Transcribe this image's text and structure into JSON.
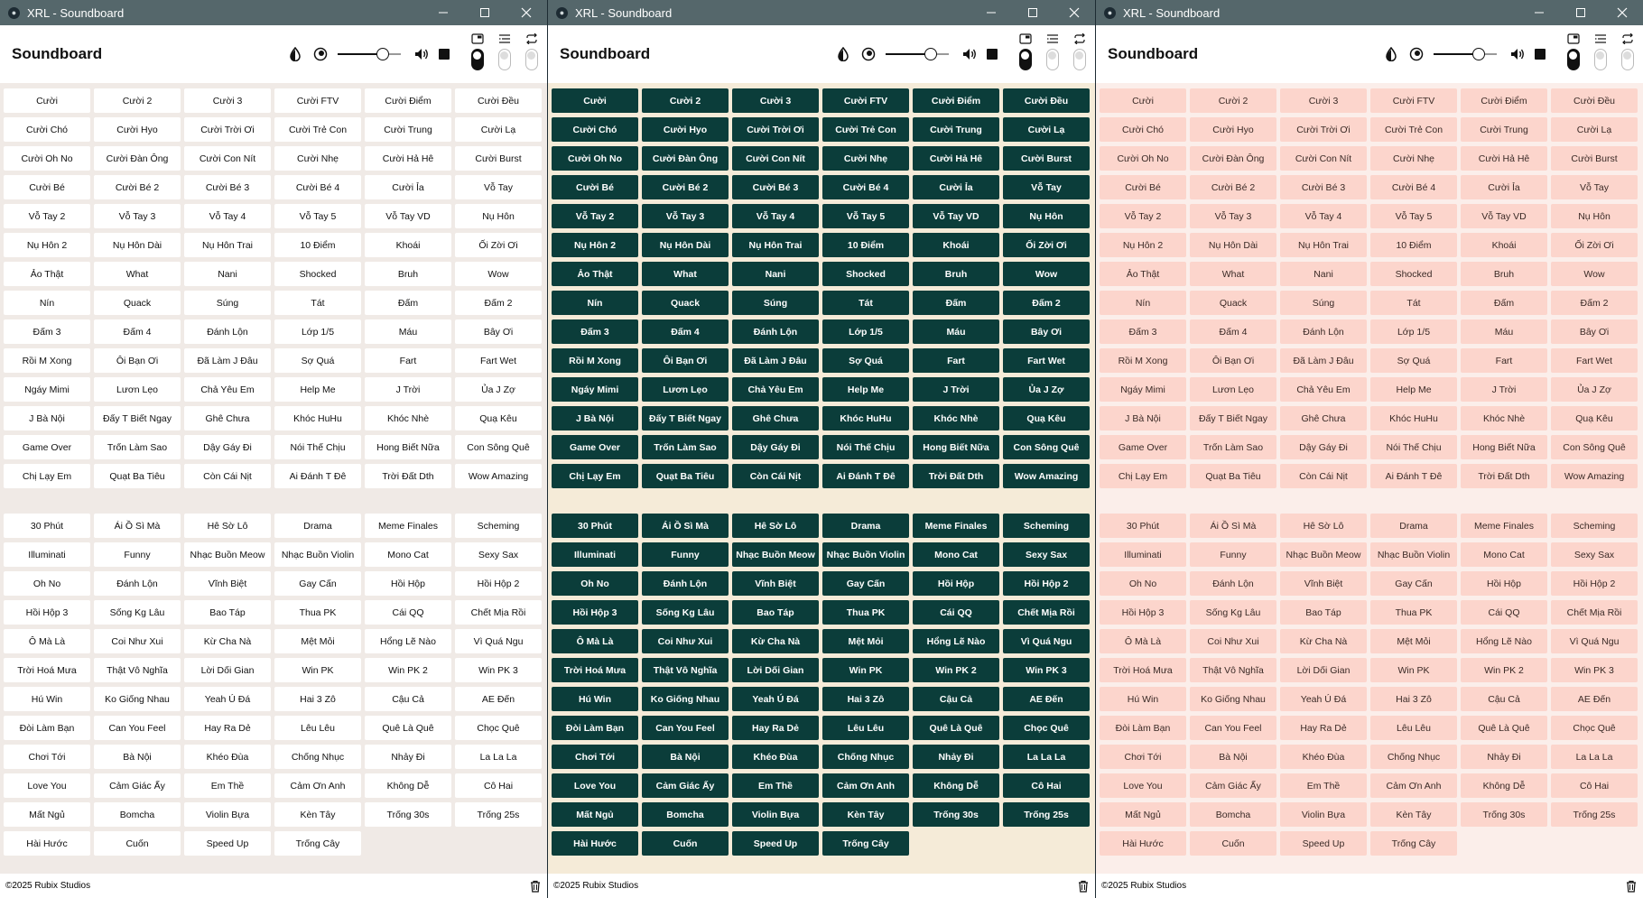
{
  "app": {
    "window_title": "XRL - Soundboard",
    "title": "Soundboard",
    "footer": "©2025 Rubix Studios",
    "volume_fraction": 0.72,
    "toggle_states": [
      true,
      false,
      false
    ]
  },
  "icons": {
    "app": "xrl-logo-icon",
    "minimize": "minimize-icon",
    "maximize": "maximize-icon",
    "close": "close-icon",
    "theme": "contrast-drop-icon",
    "mode": "circle-dot-icon",
    "volume": "speaker-icon",
    "stop": "stop-icon",
    "pip": "picture-in-picture-icon",
    "list": "list-icon",
    "repeat": "repeat-icon",
    "trash": "trash-icon"
  },
  "themes": [
    {
      "name": "light",
      "bg": "#f0eae6",
      "btn_bg": "#ffffff",
      "btn_text": "#111111"
    },
    {
      "name": "green",
      "bg": "#f5ebd8",
      "btn_bg": "#0b3d3a",
      "btn_text": "#ffffff"
    },
    {
      "name": "pink",
      "bg": "#fbeeea",
      "btn_bg": "#fcd5cc",
      "btn_text": "#3a2a26"
    }
  ],
  "sounds_group1": [
    "Cười",
    "Cười 2",
    "Cười 3",
    "Cười FTV",
    "Cười Điểm",
    "Cười Đều",
    "Cười Chó",
    "Cười Hyo",
    "Cười Trời Ơi",
    "Cười Trẻ Con",
    "Cười Trung",
    "Cười Lạ",
    "Cười Oh No",
    "Cười Đàn Ông",
    "Cười Con Nít",
    "Cười Nhẹ",
    "Cười Hả Hê",
    "Cười Burst",
    "Cười Bé",
    "Cười Bé 2",
    "Cười Bé 3",
    "Cười Bé 4",
    "Cười Ỉa",
    "Vỗ Tay",
    "Vỗ Tay 2",
    "Vỗ Tay 3",
    "Vỗ Tay 4",
    "Vỗ Tay 5",
    "Vỗ Tay VD",
    "Nụ Hôn",
    "Nụ Hôn 2",
    "Nụ Hôn Dài",
    "Nụ Hôn Trai",
    "10 Điểm",
    "Khoái",
    "Ối Zời Ơi",
    "Ảo Thật",
    "What",
    "Nani",
    "Shocked",
    "Bruh",
    "Wow",
    "Nín",
    "Quack",
    "Súng",
    "Tát",
    "Đấm",
    "Đấm 2",
    "Đấm 3",
    "Đấm 4",
    "Đánh Lộn",
    "Lớp 1/5",
    "Máu",
    "Bây Ơi",
    "Rồi M Xong",
    "Ôi Bạn Ơi",
    "Đã Làm J Đâu",
    "Sợ Quá",
    "Fart",
    "Fart Wet",
    "Ngáy Mimi",
    "Lươn Lẹo",
    "Chả Yêu Em",
    "Help Me",
    "J Trời",
    "Ủa J Zợ",
    "J Bà Nội",
    "Đấy T Biết Ngay",
    "Ghê Chưa",
    "Khóc HuHu",
    "Khóc Nhè",
    "Quạ Kêu",
    "Game Over",
    "Trốn Làm Sao",
    "Dậy Gáy Đi",
    "Nói Thế Chịu",
    "Hong Biết Nữa",
    "Con Sông Quê",
    "Chị Lạy Em",
    "Quạt Ba Tiêu",
    "Còn Cái Nịt",
    "Ai Đánh T Đê",
    "Trời Đất Dth",
    "Wow Amazing"
  ],
  "sounds_group2": [
    "30 Phút",
    "Ái Ồ Sì Mà",
    "Hê Sờ Lô",
    "Drama",
    "Meme Finales",
    "Scheming",
    "Illuminati",
    "Funny",
    "Nhạc Buồn Meow",
    "Nhạc Buồn Violin",
    "Mono Cat",
    "Sexy Sax",
    "Oh No",
    "Đánh Lộn",
    "Vĩnh Biệt",
    "Gay Cấn",
    "Hồi Hộp",
    "Hồi Hộp 2",
    "Hồi Hộp 3",
    "Sống Kg Lâu",
    "Bao Táp",
    "Thua PK",
    "Cái QQ",
    "Chết Mịa Rồi",
    "Ô Mà Là",
    "Coi Như Xui",
    "Kừ Cha Nà",
    "Mệt Mỏi",
    "Hổng Lẽ Nào",
    "Vì Quá Ngu",
    "Trời Hoá Mưa",
    "Thật Vô Nghĩa",
    "Lời Dối Gian",
    "Win PK",
    "Win PK 2",
    "Win PK 3",
    "Hú Win",
    "Ko Giống Nhau",
    "Yeah Ú Đá",
    "Hai 3 Zô",
    "Cậu Cả",
    "AE Đến",
    "Đòi Làm Bạn",
    "Can You Feel",
    "Hay Ra Dẻ",
    "Lêu Lêu",
    "Quê Là Quê",
    "Chọc Quê",
    "Chơi Tới",
    "Bà Nội",
    "Khéo Đùa",
    "Chống Nhục",
    "Nhảy Đi",
    "La La La",
    "Love You",
    "Cảm Giác Ấy",
    "Em Thề",
    "Cảm Ơn Anh",
    "Không Dễ",
    "Cô Hai",
    "Mất Ngủ",
    "Bomcha",
    "Violin Bựa",
    "Kèn Tây",
    "Trống 30s",
    "Trống 25s",
    "Hài Hước",
    "Cuốn",
    "Speed Up",
    "Trống Cây"
  ]
}
